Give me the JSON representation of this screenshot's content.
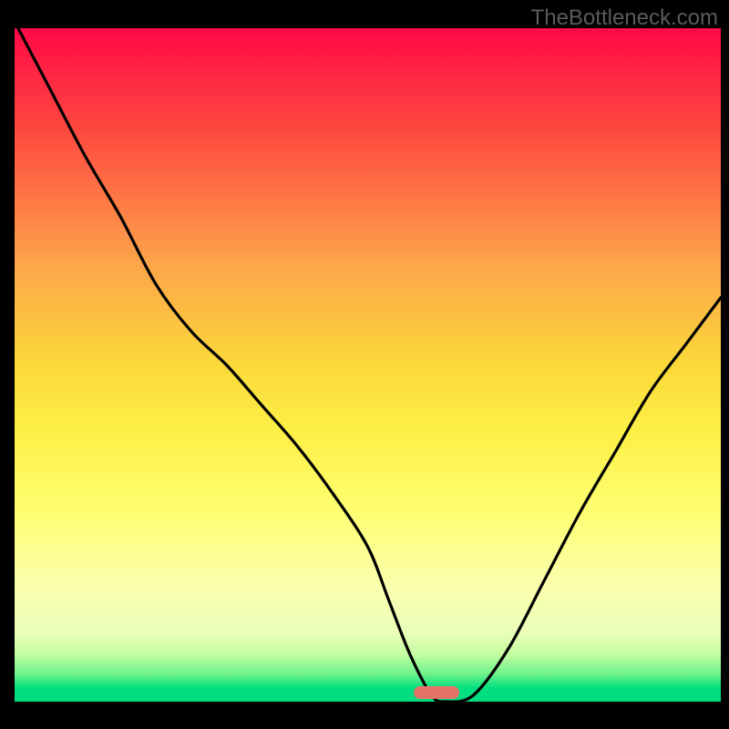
{
  "watermark": "TheBottleneck.com",
  "chart_data": {
    "type": "line",
    "title": "",
    "xlabel": "",
    "ylabel": "",
    "xlim": [
      0,
      100
    ],
    "ylim": [
      0,
      100
    ],
    "grid": false,
    "legend": false,
    "series": [
      {
        "name": "bottleneck-curve",
        "x": [
          0.5,
          5,
          10,
          15,
          20,
          25,
          30,
          35,
          40,
          45,
          50,
          53,
          56,
          59,
          61,
          65,
          70,
          75,
          80,
          85,
          90,
          95,
          100
        ],
        "values": [
          100,
          91,
          81,
          72,
          62,
          55,
          50,
          44,
          38,
          31,
          23,
          15,
          7,
          1,
          0,
          1,
          8,
          18,
          28,
          37,
          46,
          53,
          60
        ]
      }
    ],
    "marker": {
      "x_start": 56.5,
      "x_end": 63,
      "y": 0
    },
    "background_gradient": {
      "top": "#ff0a46",
      "mid": "#fbd939",
      "bottom": "#00db80"
    }
  }
}
